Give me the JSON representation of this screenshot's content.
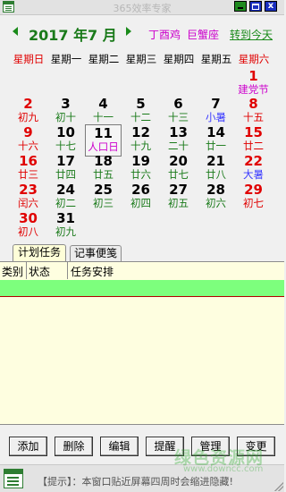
{
  "window": {
    "title": "365效率专家",
    "controls": [
      "minimize",
      "maximize",
      "close"
    ]
  },
  "header": {
    "year": "2017",
    "year_unit": "年",
    "month": "7",
    "month_unit": "月",
    "ganzhi": "丁酉鸡",
    "zodiac": "巨蟹座",
    "today_link": "转到今天",
    "colors": {
      "green": "#1a7a1a",
      "magenta": "#cc00cc",
      "red": "#e00000"
    }
  },
  "weekdays": [
    "星期日",
    "星期一",
    "星期二",
    "星期三",
    "星期四",
    "星期五",
    "星期六"
  ],
  "calendar": {
    "rows": [
      [
        null,
        null,
        null,
        null,
        null,
        null,
        {
          "day": "1",
          "lunar": "建党节",
          "day_color": "red",
          "lunar_color": "magenta"
        }
      ],
      [
        {
          "day": "2",
          "lunar": "初九",
          "day_color": "red",
          "lunar_color": "red"
        },
        {
          "day": "3",
          "lunar": "初十",
          "day_color": "black",
          "lunar_color": "green"
        },
        {
          "day": "4",
          "lunar": "十一",
          "day_color": "black",
          "lunar_color": "green"
        },
        {
          "day": "5",
          "lunar": "十二",
          "day_color": "black",
          "lunar_color": "green"
        },
        {
          "day": "6",
          "lunar": "十三",
          "day_color": "black",
          "lunar_color": "green"
        },
        {
          "day": "7",
          "lunar": "小暑",
          "day_color": "black",
          "lunar_color": "blue"
        },
        {
          "day": "8",
          "lunar": "十五",
          "day_color": "red",
          "lunar_color": "red"
        }
      ],
      [
        {
          "day": "9",
          "lunar": "十六",
          "day_color": "red",
          "lunar_color": "red"
        },
        {
          "day": "10",
          "lunar": "十七",
          "day_color": "black",
          "lunar_color": "green"
        },
        {
          "day": "11",
          "lunar": "人口日",
          "day_color": "black",
          "lunar_color": "magenta",
          "today": true
        },
        {
          "day": "12",
          "lunar": "十九",
          "day_color": "black",
          "lunar_color": "green"
        },
        {
          "day": "13",
          "lunar": "二十",
          "day_color": "black",
          "lunar_color": "green"
        },
        {
          "day": "14",
          "lunar": "廿一",
          "day_color": "black",
          "lunar_color": "green"
        },
        {
          "day": "15",
          "lunar": "廿二",
          "day_color": "red",
          "lunar_color": "red"
        }
      ],
      [
        {
          "day": "16",
          "lunar": "廿三",
          "day_color": "red",
          "lunar_color": "red"
        },
        {
          "day": "17",
          "lunar": "廿四",
          "day_color": "black",
          "lunar_color": "green"
        },
        {
          "day": "18",
          "lunar": "廿五",
          "day_color": "black",
          "lunar_color": "green"
        },
        {
          "day": "19",
          "lunar": "廿六",
          "day_color": "black",
          "lunar_color": "green"
        },
        {
          "day": "20",
          "lunar": "廿七",
          "day_color": "black",
          "lunar_color": "green"
        },
        {
          "day": "21",
          "lunar": "廿八",
          "day_color": "black",
          "lunar_color": "green"
        },
        {
          "day": "22",
          "lunar": "大暑",
          "day_color": "red",
          "lunar_color": "blue"
        }
      ],
      [
        {
          "day": "23",
          "lunar": "闰六",
          "day_color": "red",
          "lunar_color": "red"
        },
        {
          "day": "24",
          "lunar": "初二",
          "day_color": "black",
          "lunar_color": "green"
        },
        {
          "day": "25",
          "lunar": "初三",
          "day_color": "black",
          "lunar_color": "green"
        },
        {
          "day": "26",
          "lunar": "初四",
          "day_color": "black",
          "lunar_color": "green"
        },
        {
          "day": "27",
          "lunar": "初五",
          "day_color": "black",
          "lunar_color": "green"
        },
        {
          "day": "28",
          "lunar": "初六",
          "day_color": "black",
          "lunar_color": "green"
        },
        {
          "day": "29",
          "lunar": "初七",
          "day_color": "red",
          "lunar_color": "red"
        }
      ],
      [
        {
          "day": "30",
          "lunar": "初八",
          "day_color": "red",
          "lunar_color": "red"
        },
        {
          "day": "31",
          "lunar": "初九",
          "day_color": "black",
          "lunar_color": "green"
        },
        null,
        null,
        null,
        null,
        null
      ]
    ]
  },
  "tabs": [
    {
      "label": "计划任务",
      "active": true
    },
    {
      "label": "记事便笺",
      "active": false
    }
  ],
  "task_table": {
    "columns": [
      "类别",
      "状态",
      "任务安排"
    ],
    "rows": []
  },
  "buttons": [
    "添加",
    "删除",
    "编辑",
    "提醒",
    "管理",
    "变更"
  ],
  "statusbar": {
    "hint": "【提示】：本窗口贴近屏幕四周时会缩进隐藏!"
  },
  "watermark": {
    "text": "绿色资源网",
    "sub": "www.downcc.com"
  }
}
